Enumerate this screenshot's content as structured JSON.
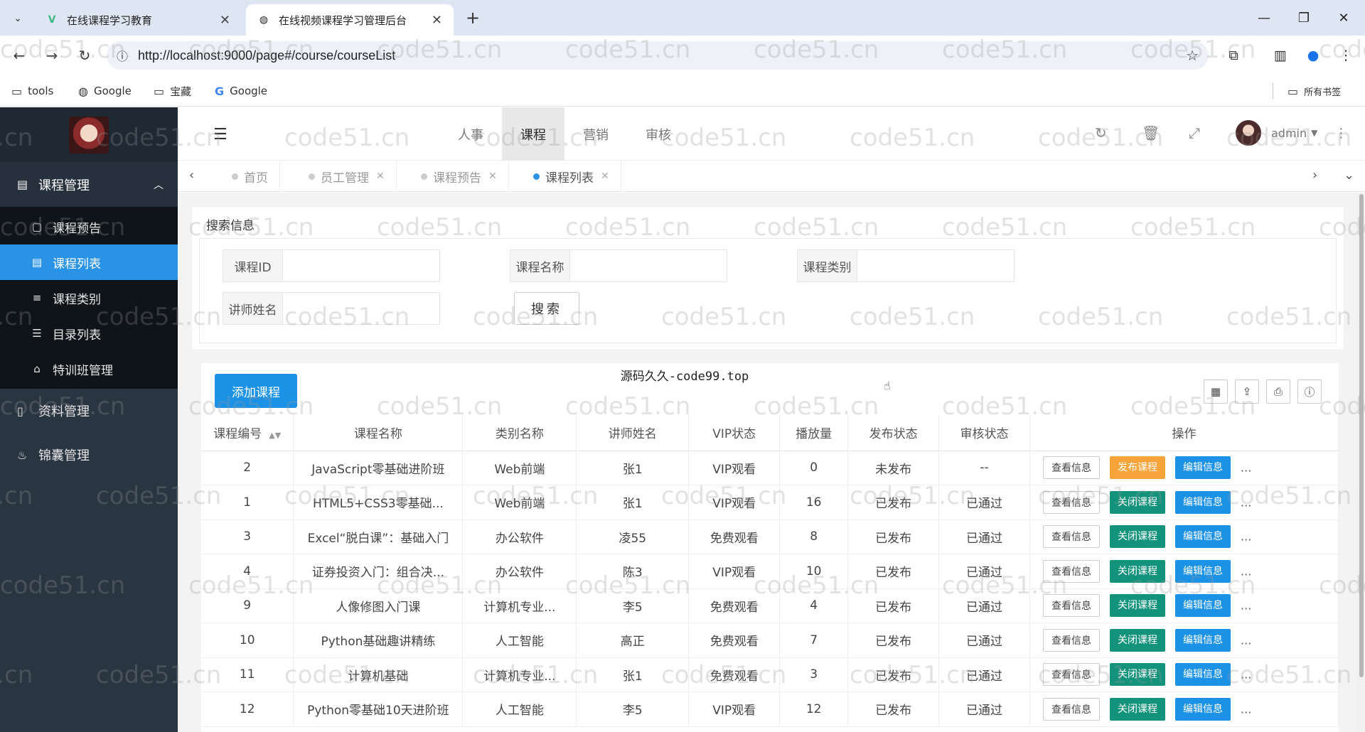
{
  "browser": {
    "tabs": [
      {
        "label": "在线课程学习教育",
        "close": "✕"
      },
      {
        "label": "在线视频课程学习管理后台",
        "close": "✕"
      }
    ],
    "new_tab": "+",
    "url": "http://localhost:9000/page#/course/courseList",
    "bookmarks": [
      {
        "label": "tools",
        "icon": "folder-icon"
      },
      {
        "label": "Google",
        "icon": "globe-icon"
      },
      {
        "label": "宝藏",
        "icon": "folder-icon"
      },
      {
        "label": "Google",
        "icon": "google-icon"
      }
    ],
    "all_bookmarks": "所有书签"
  },
  "sidebar": {
    "group1": {
      "label": "课程管理",
      "icon": "book-icon"
    },
    "items": [
      {
        "label": "课程预告",
        "icon": "preview-icon",
        "active": false
      },
      {
        "label": "课程列表",
        "icon": "list-icon",
        "active": true
      },
      {
        "label": "课程类别",
        "icon": "bars-icon",
        "active": false
      },
      {
        "label": "目录列表",
        "icon": "sliders-icon",
        "active": false
      },
      {
        "label": "特训班管理",
        "icon": "bank-icon",
        "active": false
      }
    ],
    "group2": {
      "label": "资料管理",
      "icon": "file-icon"
    },
    "group3": {
      "label": "锦囊管理",
      "icon": "bag-icon"
    }
  },
  "topnav": {
    "tabs": [
      "人事",
      "课程",
      "营销",
      "审核"
    ],
    "active_tab": "课程",
    "user": "admin"
  },
  "page_tabs": [
    {
      "label": "首页",
      "closable": false,
      "active": false
    },
    {
      "label": "员工管理",
      "closable": true,
      "active": false
    },
    {
      "label": "课程预告",
      "closable": true,
      "active": false
    },
    {
      "label": "课程列表",
      "closable": true,
      "active": true
    }
  ],
  "search": {
    "title": "搜索信息",
    "fields": [
      {
        "label": "课程ID",
        "value": ""
      },
      {
        "label": "课程名称",
        "value": ""
      },
      {
        "label": "课程类别",
        "value": ""
      },
      {
        "label": "讲师姓名",
        "value": ""
      }
    ],
    "button": "搜索"
  },
  "table": {
    "add_button": "添加课程",
    "title": "源码久久-code99.top",
    "headers": [
      "课程编号",
      "课程名称",
      "类别名称",
      "讲师姓名",
      "VIP状态",
      "播放量",
      "发布状态",
      "审核状态",
      "操作"
    ],
    "rows": [
      {
        "id": "2",
        "name": "JavaScript零基础进阶班",
        "category": "Web前端",
        "teacher": "张1",
        "vip": "VIP观看",
        "plays": "0",
        "publish": "未发布",
        "audit": "--",
        "action2": "发布课程"
      },
      {
        "id": "1",
        "name": "HTML5+CSS3零基础...",
        "category": "Web前端",
        "teacher": "张1",
        "vip": "VIP观看",
        "plays": "16",
        "publish": "已发布",
        "audit": "已通过",
        "action2": "关闭课程"
      },
      {
        "id": "3",
        "name": "Excel“脱白课”：基础入门",
        "category": "办公软件",
        "teacher": "凌55",
        "vip": "免费观看",
        "plays": "8",
        "publish": "已发布",
        "audit": "已通过",
        "action2": "关闭课程"
      },
      {
        "id": "4",
        "name": "证券投资入门：组合决...",
        "category": "办公软件",
        "teacher": "陈3",
        "vip": "VIP观看",
        "plays": "10",
        "publish": "已发布",
        "audit": "已通过",
        "action2": "关闭课程"
      },
      {
        "id": "9",
        "name": "人像修图入门课",
        "category": "计算机专业...",
        "teacher": "李5",
        "vip": "免费观看",
        "plays": "4",
        "publish": "已发布",
        "audit": "已通过",
        "action2": "关闭课程"
      },
      {
        "id": "10",
        "name": "Python基础趣讲精练",
        "category": "人工智能",
        "teacher": "高正",
        "vip": "免费观看",
        "plays": "7",
        "publish": "已发布",
        "audit": "已通过",
        "action2": "关闭课程"
      },
      {
        "id": "11",
        "name": "计算机基础",
        "category": "计算机专业...",
        "teacher": "张1",
        "vip": "免费观看",
        "plays": "3",
        "publish": "已发布",
        "audit": "已通过",
        "action2": "关闭课程"
      },
      {
        "id": "12",
        "name": "Python零基础10天进阶班",
        "category": "人工智能",
        "teacher": "李5",
        "vip": "VIP观看",
        "plays": "12",
        "publish": "已发布",
        "audit": "已通过",
        "action2": "关闭课程"
      }
    ],
    "view_label": "查看信息",
    "edit_label": "编辑信息",
    "more": "..."
  },
  "watermark": "code51.cn",
  "colors": {
    "accent": "#1c92e6",
    "sidebar": "#2a3542",
    "publish_btn": "#f7a53a",
    "close_btn": "#13937c",
    "unpublished": "#e03535",
    "published": "#1aa64d"
  }
}
